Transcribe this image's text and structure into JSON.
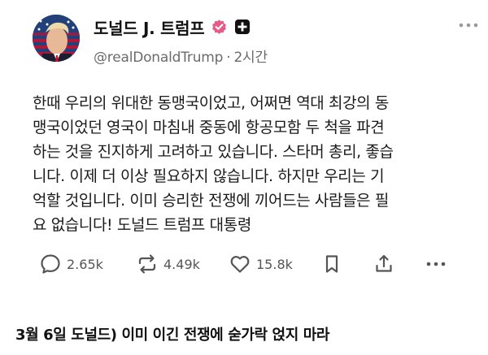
{
  "post": {
    "display_name": "도널드 J. 트럼프",
    "handle": "@realDonaldTrump",
    "separator": "·",
    "time_ago": "2시간",
    "body_lines": [
      "한때 우리의 위대한 동맹국이었고, 어쩌면 역대 최강의 동",
      "맹국이었던 영국이 마침내 중동에 항공모함 두 척을 파견",
      "하는 것을 진지하게 고려하고 있습니다. 스타머 총리, 좋습",
      "니다. 이제 더 이상 필요하지 않습니다. 하지만 우리는 기",
      "억할 것입니다. 이미 승리한 전쟁에 끼어드는 사람들은 필",
      "요 없습니다! 도널드 트럼프 대통령"
    ],
    "stats": {
      "replies": "2.65k",
      "reposts": "4.49k",
      "likes": "15.8k"
    },
    "icons": {
      "verified": "verified-badge-icon",
      "platform": "truth-social-badge-icon",
      "more": "more-horizontal-icon",
      "reply": "comment-icon",
      "repost": "repost-icon",
      "like": "heart-icon",
      "save": "bookmark-icon",
      "share": "share-icon"
    },
    "colors": {
      "verified": "#e55d87",
      "text": "#1a1a1a",
      "muted": "#6b6b6b"
    }
  },
  "caption": "3월 6일 도널드) 이미 이긴 전쟁에 숟가락 얹지 마라"
}
